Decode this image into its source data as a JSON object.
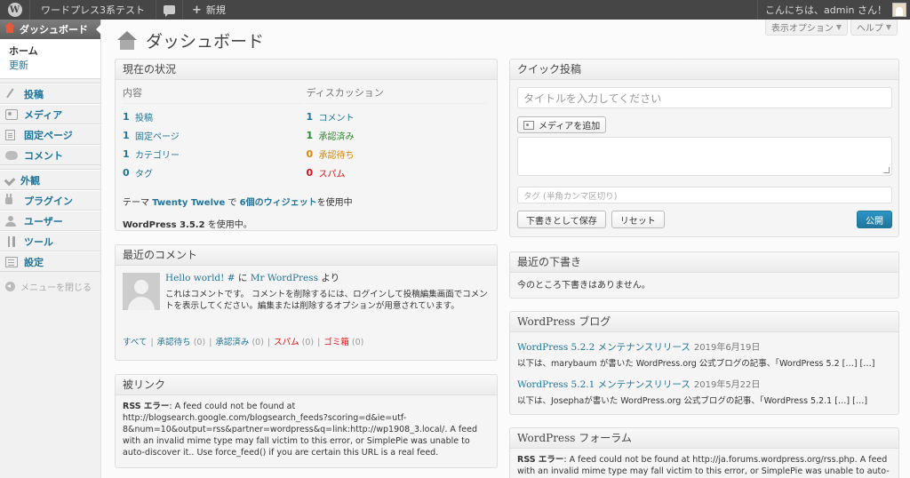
{
  "adminbar": {
    "site_name": "ワードプレス3系テスト",
    "new_label": "新規",
    "greeting": "こんにちは、admin さん！"
  },
  "menu": {
    "dashboard": "ダッシュボード",
    "sub_home": "ホーム",
    "sub_updates": "更新",
    "items": [
      {
        "label": "投稿",
        "icon": "pin-icon"
      },
      {
        "label": "メディア",
        "icon": "media-icon"
      },
      {
        "label": "固定ページ",
        "icon": "page-icon"
      },
      {
        "label": "コメント",
        "icon": "comment-icon"
      },
      {
        "label": "外観",
        "icon": "brush-icon"
      },
      {
        "label": "プラグイン",
        "icon": "plugin-icon"
      },
      {
        "label": "ユーザー",
        "icon": "users-icon"
      },
      {
        "label": "ツール",
        "icon": "tools-icon"
      },
      {
        "label": "設定",
        "icon": "settings-icon"
      }
    ],
    "collapse": "メニューを閉じる"
  },
  "header": {
    "title": "ダッシュボード",
    "screen_options": "表示オプション",
    "help": "ヘルプ"
  },
  "right_now": {
    "title": "現在の状況",
    "content_head": "内容",
    "discussion_head": "ディスカッション",
    "content": [
      {
        "num": "1",
        "label": "投稿"
      },
      {
        "num": "1",
        "label": "固定ページ"
      },
      {
        "num": "1",
        "label": "カテゴリー"
      },
      {
        "num": "0",
        "label": "タグ"
      }
    ],
    "discussion": [
      {
        "num": "1",
        "label": "コメント"
      },
      {
        "num": "1",
        "label": "承認済み"
      },
      {
        "num": "0",
        "label": "承認待ち"
      },
      {
        "num": "0",
        "label": "スパム"
      }
    ],
    "theme_prefix": "テーマ ",
    "theme_name": "Twenty Twelve",
    "theme_mid": " で ",
    "widgets": "6個のウィジェット",
    "theme_suffix": "を使用中",
    "version": "WordPress 3.5.2",
    "version_suffix": " を使用中。"
  },
  "recent_comments": {
    "title": "最近のコメント",
    "post_link": "Hello world! #",
    "by_mid": " に ",
    "author": "Mr WordPress",
    "by_suffix": " より",
    "text": "これはコメントです。 コメントを削除するには、ログインして投稿編集画面でコメントを表示してください。編集または削除するオプションが用意されています。",
    "links": {
      "all": "すべて",
      "pending": "承認待ち",
      "pending_count": "(0)",
      "approved": "承認済み",
      "approved_count": "(0)",
      "spam": "スパム",
      "spam_count": "(0)",
      "trash": "ゴミ箱",
      "trash_count": "(0)"
    }
  },
  "incoming_links": {
    "title": "被リンク",
    "error_label": "RSS エラー",
    "error_text": ": A feed could not be found at http://blogsearch.google.com/blogsearch_feeds?scoring=d&ie=utf-8&num=10&output=rss&partner=wordpress&q=link:http://wp1908_3.local/. A feed with an invalid mime type may fall victim to this error, or SimplePie was unable to auto-discover it.. Use force_feed() if you are certain this URL is a real feed."
  },
  "quick_press": {
    "title": "クイック投稿",
    "title_placeholder": "タイトルを入力してください",
    "add_media": "メディアを追加",
    "tags_placeholder": "タグ (半角カンマ区切り)",
    "save_draft": "下書きとして保存",
    "reset": "リセット",
    "publish": "公開"
  },
  "recent_drafts": {
    "title": "最近の下書き",
    "empty": "今のところ下書きはありません。"
  },
  "wp_blog": {
    "title": "WordPress ブログ",
    "items": [
      {
        "title": "WordPress 5.2.2 メンテナンスリリース",
        "date": "2019年6月19日",
        "excerpt": "以下は、marybaum が書いた WordPress.org 公式ブログの記事、「WordPress 5.2 […] […]"
      },
      {
        "title": "WordPress 5.2.1 メンテナンスリリース",
        "date": "2019年5月22日",
        "excerpt": "以下は、Josephaが書いた WordPress.org 公式ブログの記事、「WordPress 5.2.1 […] […]"
      }
    ]
  },
  "wp_forum": {
    "title": "WordPress フォーラム",
    "error_label": "RSS エラー",
    "error_text": ": A feed could not be found at http://ja.forums.wordpress.org/rss.php. A feed with an invalid mime type may fall victim to this error, or SimplePie was unable to auto-"
  },
  "colors": {
    "link": "#21759b",
    "approved": "#2a8b2a",
    "pending": "#d98500",
    "spam": "#dd1111",
    "admin_bar": "#464646"
  }
}
